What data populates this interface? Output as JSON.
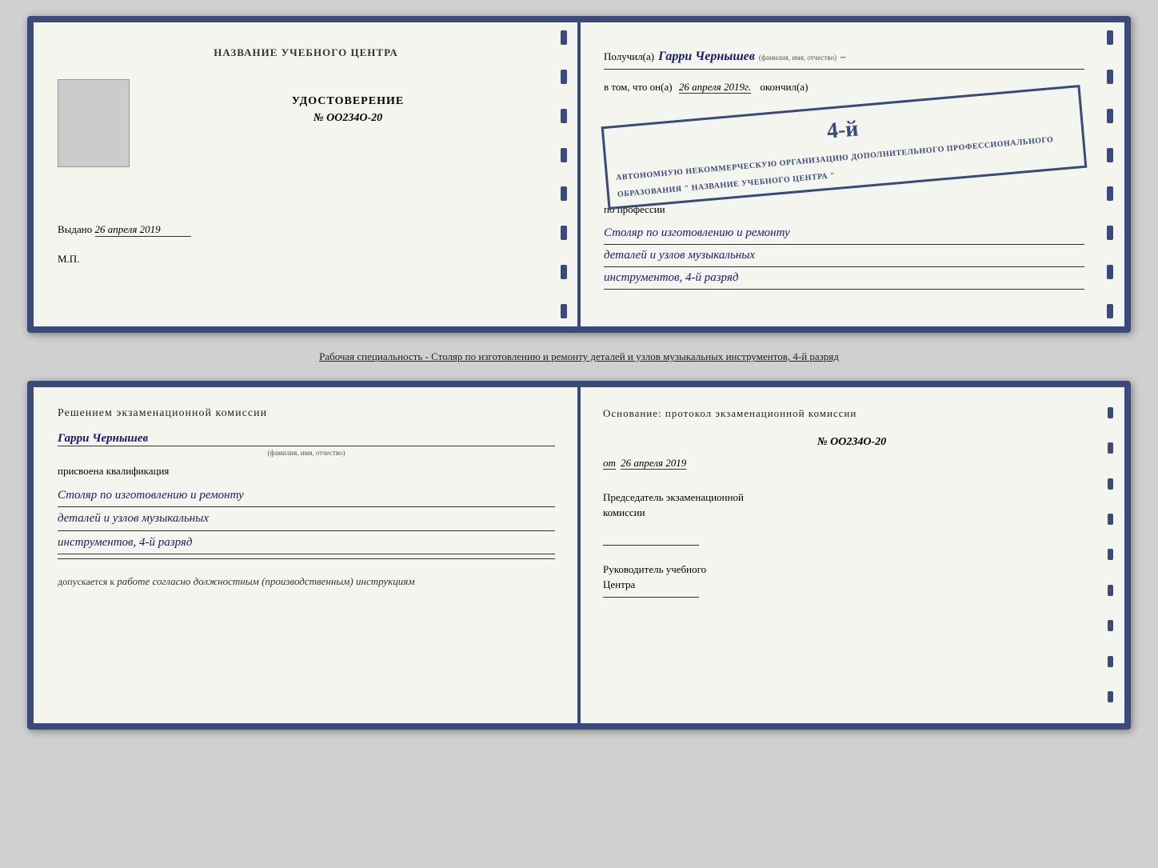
{
  "top_spread": {
    "left_page": {
      "center_label": "НАЗВАНИЕ УЧЕБНОГО ЦЕНТРА",
      "cert_title": "УДОСТОВЕРЕНИЕ",
      "cert_number": "№ OO234O-20",
      "issued_label": "Выдано",
      "issued_date": "26 апреля 2019",
      "mp_label": "М.П."
    },
    "right_page": {
      "received_label": "Получил(а)",
      "recipient_name": "Гарри Чернышев",
      "fio_label": "(фамилия, имя, отчество)",
      "in_that_label": "в том, что он(а)",
      "date_value": "26 апреля 2019г.",
      "finished_label": "окончил(а)",
      "stamp_number": "4-й",
      "stamp_line1": "АВТОНОМНУЮ НЕКОММЕРЧЕСКУЮ ОРГАНИЗАЦИЮ",
      "stamp_line2": "ДОПОЛНИТЕЛЬНОГО ПРОФЕССИОНАЛЬНОГО ОБРАЗОВАНИЯ",
      "stamp_line3": "\" НАЗВАНИЕ УЧЕБНОГО ЦЕНТРА \"",
      "profession_label": "по профессии",
      "profession_line1": "Столяр по изготовлению и ремонту",
      "profession_line2": "деталей и узлов музыкальных",
      "profession_line3": "инструментов, 4-й разряд"
    }
  },
  "caption": "Рабочая специальность - Столяр по изготовлению и ремонту деталей и узлов музыкальных инструментов, 4-й разряд",
  "bottom_spread": {
    "left_page": {
      "title": "Решением  экзаменационной  комиссии",
      "person_name": "Гарри Чернышев",
      "fio_label": "(фамилия, имя, отчество)",
      "assigned_text": "присвоена квалификация",
      "qualification_line1": "Столяр по изготовлению и ремонту",
      "qualification_line2": "деталей и узлов музыкальных",
      "qualification_line3": "инструментов, 4-й разряд",
      "allowed_prefix": "допускается к",
      "allowed_text": "работе согласно должностным (производственным) инструкциям"
    },
    "right_page": {
      "basis_title": "Основание:  протокол  экзаменационной  комиссии",
      "protocol_number": "№  OO234O-20",
      "from_label": "от",
      "from_date": "26 апреля 2019",
      "chairman_title_line1": "Председатель экзаменационной",
      "chairman_title_line2": "комиссии",
      "director_title_line1": "Руководитель учебного",
      "director_title_line2": "Центра"
    }
  }
}
